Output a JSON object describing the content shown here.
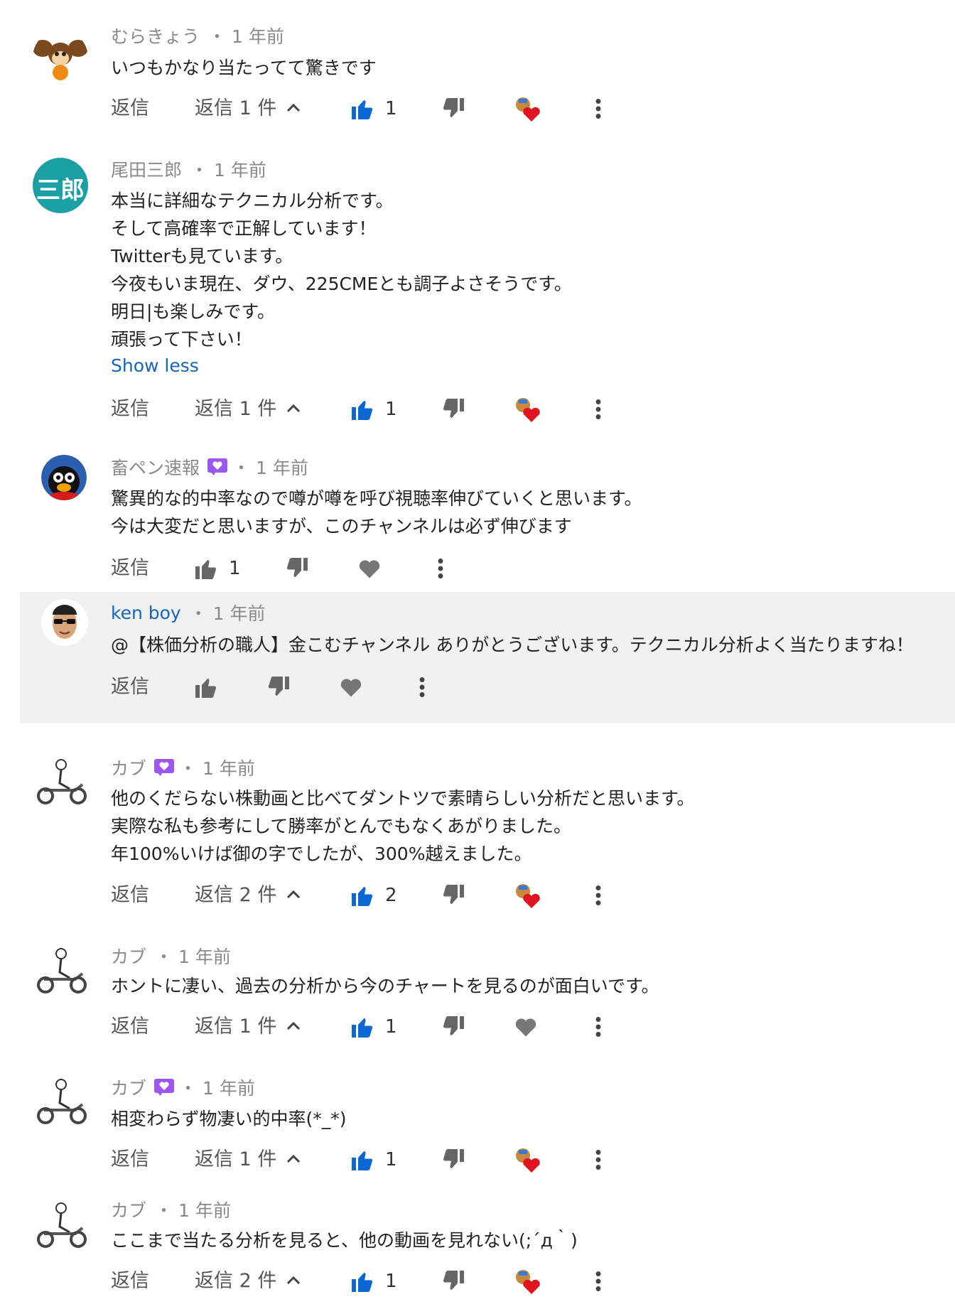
{
  "comments": [
    {
      "author": "むらきょう",
      "time": "・ 1 年前",
      "lines": "いつもかなり当たってて驚きです",
      "reply": "返信",
      "replies": "返信 1 件",
      "likes": "1",
      "heart": "creator-heart"
    },
    {
      "author": "尾田三郎",
      "time": "・ 1 年前",
      "avatar_text": "三郎",
      "lines": "本当に詳細なテクニカル分析です。\nそして高確率で正解しています！\nTwitterも見ています。\n今夜もいま現在、ダウ、225CMEとも調子よさそうです。\n明日|も楽しみです。\n頑張って下さい！",
      "show_less": "Show less",
      "reply": "返信",
      "replies": "返信 1 件",
      "likes": "1",
      "heart": "creator-heart"
    },
    {
      "author": "畜ペン速報",
      "time": "・ 1 年前",
      "lines": "驚異的な的中率なので噂が噂を呼び視聴率伸びていくと思います。\n今は大変だと思いますが、このチャンネルは必ず伸びます",
      "reply": "返信",
      "likes": "1",
      "heart": "heart-outline"
    },
    {
      "author": "ken boy",
      "time": "・ 1 年前",
      "lines": "@【株価分析の職人】金こむチャンネル ありがとうございます。テクニカル分析よく当たりますね！",
      "reply": "返信",
      "likes": "",
      "heart": "heart-outline"
    },
    {
      "author": "カブ",
      "time": "・ 1 年前",
      "lines": "他のくだらない株動画と比べてダントツで素晴らしい分析だと思います。\n実際な私も参考にして勝率がとんでもなくあがりました。\n年100%いけば御の字でしたが、300%越えました。",
      "reply": "返信",
      "replies": "返信 2 件",
      "likes": "2",
      "heart": "creator-heart"
    },
    {
      "author": "カブ",
      "time": "・ 1 年前",
      "lines": "ホントに凄い、過去の分析から今のチャートを見るのが面白いです。",
      "reply": "返信",
      "replies": "返信 1 件",
      "likes": "1",
      "heart": "heart-outline"
    },
    {
      "author": "カブ",
      "time": "・ 1 年前",
      "lines": "相変わらず物凄い的中率(*_*)",
      "reply": "返信",
      "replies": "返信 1 件",
      "likes": "1",
      "heart": "creator-heart"
    },
    {
      "author": "カブ",
      "time": "・ 1 年前",
      "lines": "ここまで当たる分析を見ると、他の動画を見れない(;´д｀)",
      "reply": "返信",
      "replies": "返信 2 件",
      "likes": "1",
      "heart": "creator-heart"
    }
  ],
  "colors": {
    "like_blue": "#0b66d6",
    "heart_red": "#e0141e",
    "badge_purple": "#9b57f0",
    "link_blue": "#1565c0",
    "highlight_bg": "#f1f1f1",
    "avatar_teal": "#1ba0a5"
  }
}
